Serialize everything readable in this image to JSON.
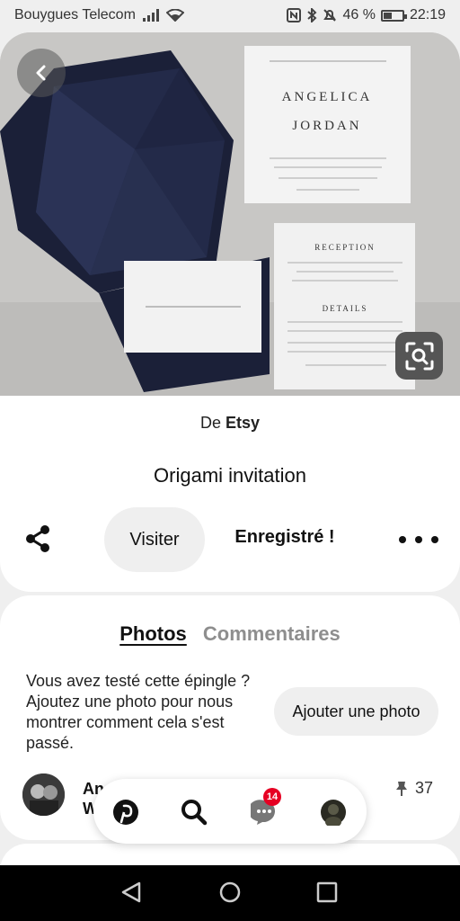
{
  "status_bar": {
    "carrier": "Bouygues Telecom",
    "battery": "46 %",
    "battery_level": 0.46,
    "time": "22:19"
  },
  "pin": {
    "source_prefix": "De",
    "source_name": "Etsy",
    "title": "Origami invitation",
    "visit_label": "Visiter",
    "saved_label": "Enregistré !"
  },
  "photo_text": {
    "name1": "ANGELICA",
    "name2": "JORDAN",
    "reception": "RECEPTION",
    "details": "DETAILS"
  },
  "tabs": {
    "photos": "Photos",
    "comments": "Commentaires"
  },
  "tried_section": {
    "prompt": "Vous avez testé cette épingle ? Ajoutez une photo pour nous montrer comment cela s'est passé.",
    "add_photo_label": "Ajouter une photo"
  },
  "pinner": {
    "name_line1": "An",
    "name_line2": "W",
    "pin_count": "37"
  },
  "nav": {
    "notifications_badge": "14"
  },
  "colors": {
    "brand_red": "#e60023",
    "navy": "#1e2440"
  }
}
